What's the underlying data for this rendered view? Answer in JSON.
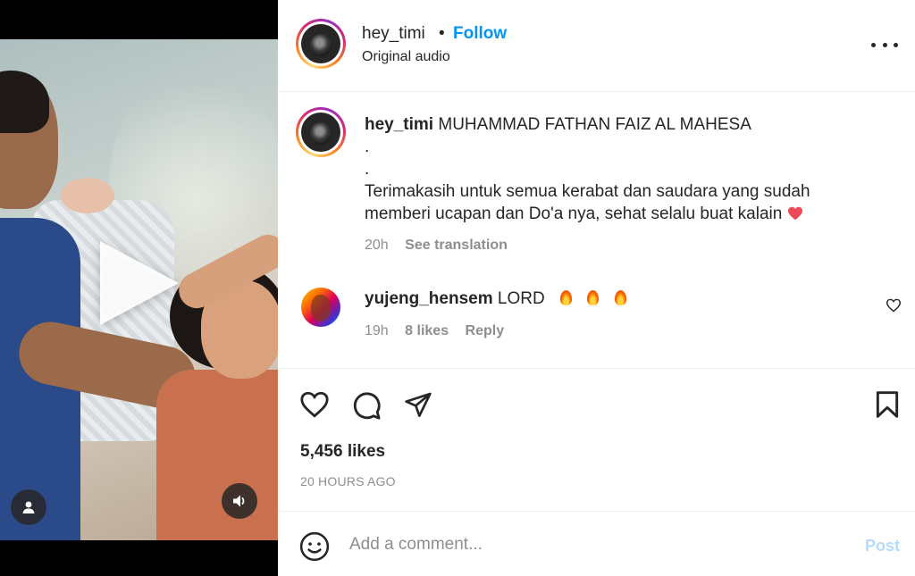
{
  "header": {
    "username": "hey_timi",
    "separator": "•",
    "follow_label": "Follow",
    "audio_label": "Original audio"
  },
  "caption": {
    "username": "hey_timi",
    "title": "MUHAMMAD FATHAN FAIZ AL MAHESA",
    "dot1": ".",
    "dot2": ".",
    "body": "Terimakasih untuk semua kerabat dan saudara yang sudah memberi ucapan dan Do'a nya, sehat selalu buat kalain",
    "heart_emoji": "❤️",
    "time": "20h",
    "see_translation": "See translation"
  },
  "comment": {
    "username": "yujeng_hensem",
    "text": "LORD",
    "emojis": [
      "fire",
      "fire",
      "fire"
    ],
    "time": "19h",
    "likes": "8 likes",
    "reply": "Reply"
  },
  "post": {
    "likes": "5,456 likes",
    "time_ago": "20 HOURS AGO"
  },
  "add_comment": {
    "placeholder": "Add a comment...",
    "post_label": "Post"
  },
  "icons": {
    "like": "heart-icon",
    "comment": "comment-icon",
    "share": "share-icon",
    "save": "bookmark-icon",
    "emoji": "emoji-icon",
    "more": "more-icon",
    "play": "play-icon",
    "mute": "volume-icon",
    "tagged_users": "user-icon"
  },
  "colors": {
    "follow": "#0095f6",
    "post_disabled": "#b3dbff",
    "muted_text": "#8e8e8e",
    "heart": "#ed4956"
  }
}
